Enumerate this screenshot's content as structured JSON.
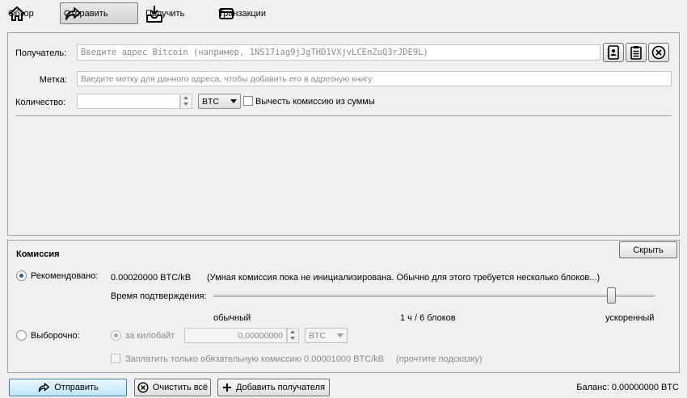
{
  "toolbar": {
    "overview": "Обзор",
    "send": "Отправить",
    "receive": "Получить",
    "transactions": "Транзакции"
  },
  "recipient": {
    "pay_to_label": "Получатель:",
    "pay_to_placeholder": "Введите адрес Bitcoin (например, 1NS17iag9jJgTHD1VXjvLCEnZuQ3rJDE9L)",
    "label_label": "Метка:",
    "label_placeholder": "Введите метку для данного адреса, чтобы добавить его в адресную книгу",
    "amount_label": "Количество:",
    "amount_value": "",
    "unit": "BTC",
    "subtract_fee_label": "Вычесть комиссию из суммы"
  },
  "fee": {
    "title": "Комиссия",
    "hide_button": "Скрыть",
    "recommended_label": "Рекомендовано:",
    "recommended_value": "0.00020000 BTC/kB",
    "smart_fee_note": "(Умная комиссия пока не инициализирована. Обычно для этого требуется несколько блоков...)",
    "confirmation_time_label": "Время подтверждения:",
    "slider_level": 0.91,
    "normal_label": "обычный",
    "target_label": "1 ч / 6 блоков",
    "fast_label": "ускоренный",
    "custom_label": "Выборочно:",
    "per_kb_label": "за килобайт",
    "custom_fee_value": "0.00000000",
    "custom_unit": "BTC",
    "min_fee_label": "Заплатить только обязательную комиссию 0.00001000 BTC/kB",
    "read_tooltip": "(прочтите подсказку)"
  },
  "bottom": {
    "send_button": "Отправить",
    "clear_button": "Очистить всё",
    "add_recipient_button": "Добавить получателя",
    "balance": "Баланс: 0.00000000 BTC"
  }
}
